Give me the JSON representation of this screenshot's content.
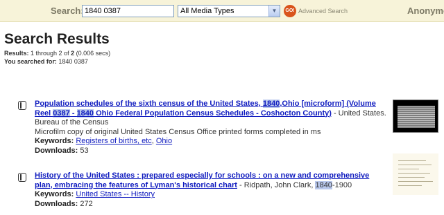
{
  "header": {
    "search_label": "Search:",
    "search_value": "1840 0387",
    "media_select_value": "All Media Types",
    "go_label": "GO!",
    "advanced_search": "Advanced Search",
    "user": "Anonymous"
  },
  "page_title": "Search Results",
  "results_meta": {
    "results_label": "Results:",
    "results_text": "1 through 2 of",
    "results_total": "2",
    "results_time": "(0.006 secs)",
    "searched_label": "You searched for:",
    "searched_value": "1840 0387"
  },
  "results": [
    {
      "title_a": "Population schedules of the sixth census of the United States, ",
      "title_b": "1840",
      "title_c": ",Ohio [microform] (Volume Reel ",
      "title_d": "0387",
      "title_e": " - ",
      "title_f": "1840",
      "title_g": " Ohio Federal Population Census Schedules - Coshocton County)",
      "author": " - United States. Bureau of the Census",
      "description": "Microfilm copy of original United States Census Office printed forms completed in ms",
      "keywords_label": "Keywords:",
      "keyword_1": "Registers of births, etc",
      "keyword_sep": ", ",
      "keyword_2": "Ohio",
      "downloads_label": "Downloads:",
      "downloads": "53"
    },
    {
      "title": "History of the United States : prepared especially for schools : on a new and comprehensive plan, embracing the features of Lyman's historical chart",
      "author_a": " - Ridpath, John Clark, ",
      "author_hl": "1840",
      "author_b": "-1900",
      "keywords_label": "Keywords:",
      "keyword_1": "United States -- History",
      "downloads_label": "Downloads:",
      "downloads": "272"
    }
  ]
}
